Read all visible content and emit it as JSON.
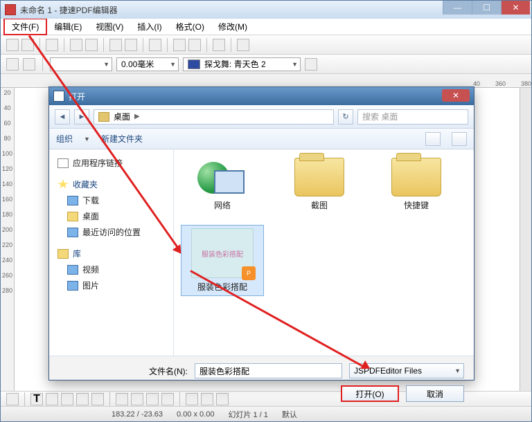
{
  "app": {
    "title": "未命名 1 - 捷速PDF编辑器",
    "menus": [
      "文件(F)",
      "编辑(E)",
      "视图(V)",
      "插入(I)",
      "格式(O)",
      "修改(M)"
    ]
  },
  "toolbar2": {
    "measurement": "0.00毫米",
    "color_name": "探戈舞: 青天色 2"
  },
  "ruler_h": [
    "40",
    "360",
    "380"
  ],
  "ruler_v": [
    "20",
    "40",
    "60",
    "80",
    "100",
    "120",
    "140",
    "160",
    "180",
    "200",
    "220",
    "240",
    "260",
    "280"
  ],
  "dialog": {
    "title": "打开",
    "location": "桌面",
    "search_placeholder": "搜索 桌面",
    "toolbar": {
      "organize": "组织",
      "newfolder": "新建文件夹"
    },
    "sidebar": {
      "app_links": "应用程序链接",
      "favorites": "收藏夹",
      "fav_items": [
        "下载",
        "桌面",
        "最近访问的位置"
      ],
      "library": "库",
      "lib_items": [
        "视频",
        "图片"
      ]
    },
    "files": {
      "network": "网络",
      "screenshot": "截图",
      "shortcut": "快捷键",
      "selected": "服装色彩搭配",
      "thumb_text": "服装色彩搭配"
    },
    "filename_label": "文件名(N):",
    "filename_value": "服装色彩搭配",
    "filetype": "JSPDFEditor Files",
    "open_btn": "打开(O)",
    "cancel_btn": "取消"
  },
  "statusbar": {
    "coords": "183.22 / -23.63",
    "size": "0.00 x 0.00",
    "slide": "幻灯片 1 / 1",
    "default": "默认"
  }
}
